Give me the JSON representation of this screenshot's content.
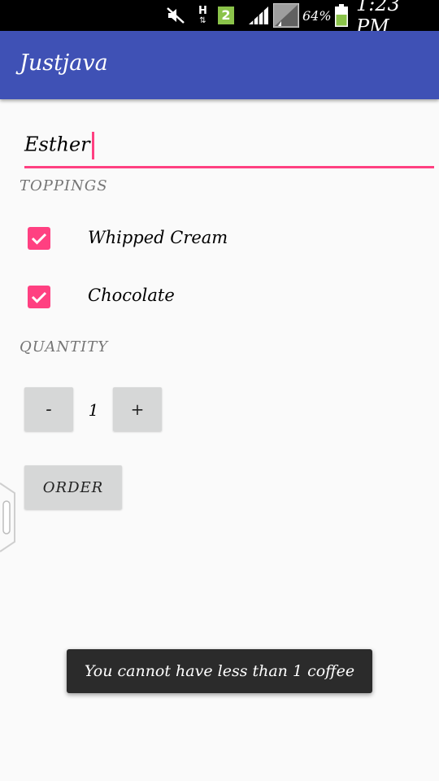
{
  "status_bar": {
    "network_type": "H",
    "sim_badge": "2",
    "battery_percent": "64%",
    "time": "1:23 PM",
    "icons": [
      "mute-icon",
      "data-arrows-icon",
      "signal-icon",
      "photo-icon",
      "battery-icon"
    ]
  },
  "app_bar": {
    "title": "Justjava"
  },
  "name_input": {
    "value": "Esther"
  },
  "toppings": {
    "label": "TOPPINGS",
    "items": [
      {
        "label": "Whipped Cream",
        "checked": true
      },
      {
        "label": "Chocolate",
        "checked": true
      }
    ]
  },
  "quantity": {
    "label": "QUANTITY",
    "decrement_label": "-",
    "value": "1",
    "increment_label": "+"
  },
  "order_button": {
    "label": "ORDER"
  },
  "toast": {
    "message": "You cannot have less than 1 coffee"
  },
  "colors": {
    "primary": "#3f51b5",
    "accent": "#ff4081",
    "button": "#d6d7d7",
    "toast": "#2b2b2b"
  }
}
